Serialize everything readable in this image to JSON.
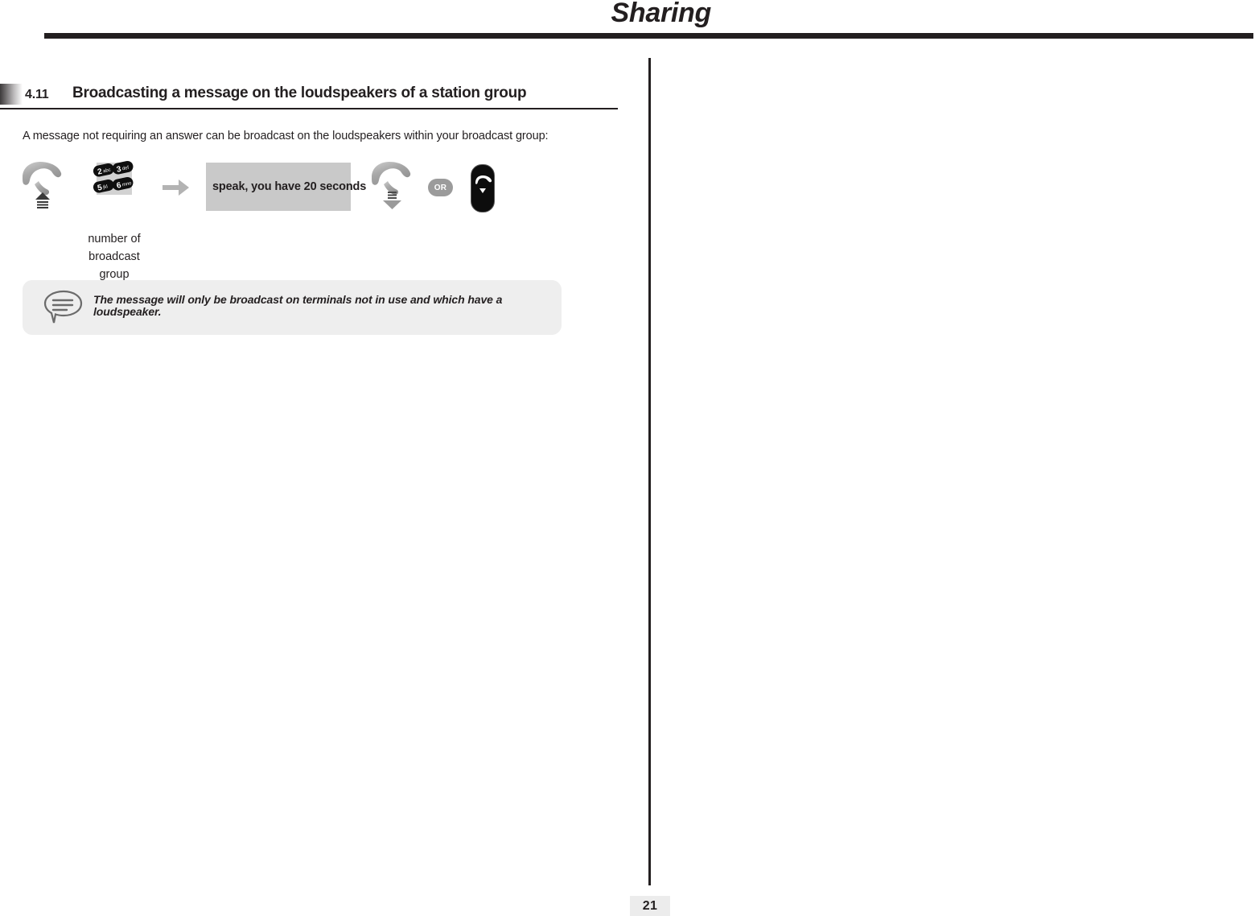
{
  "header": {
    "running_title": "Sharing"
  },
  "section": {
    "number": "4.11",
    "title": "Broadcasting a message on the loudspeakers of a station group"
  },
  "intro": {
    "text": "A message not requiring an answer can be broadcast on the loudspeakers within your broadcast group:"
  },
  "sequence": {
    "steps": [
      {
        "icon": "lift-handset-icon",
        "caption": ""
      },
      {
        "icon": "keypad-icon",
        "caption": "number of broadcast group",
        "keys": [
          "2abc",
          "3def",
          "5jkl",
          "6mno"
        ]
      },
      {
        "icon": "right-arrow-icon",
        "caption": ""
      },
      {
        "icon": "prompt-box",
        "caption": "",
        "prompt": "speak, you have 20 seconds"
      },
      {
        "icon": "hang-up-handset-icon",
        "caption": ""
      },
      {
        "icon": "or-badge",
        "caption": "",
        "label": "OR"
      },
      {
        "icon": "release-key-icon",
        "caption": ""
      }
    ]
  },
  "note": {
    "icon": "speech-bubble-icon",
    "text": "The message will only be broadcast on terminals not in use and which have a loudspeaker."
  },
  "footer": {
    "page_number": "21"
  },
  "colors": {
    "ink": "#231f20",
    "prompt_background": "#c9c9c9",
    "note_background": "#eeeeee",
    "or_badge_background": "#9b9b9b",
    "page_number_background": "#ececec"
  }
}
